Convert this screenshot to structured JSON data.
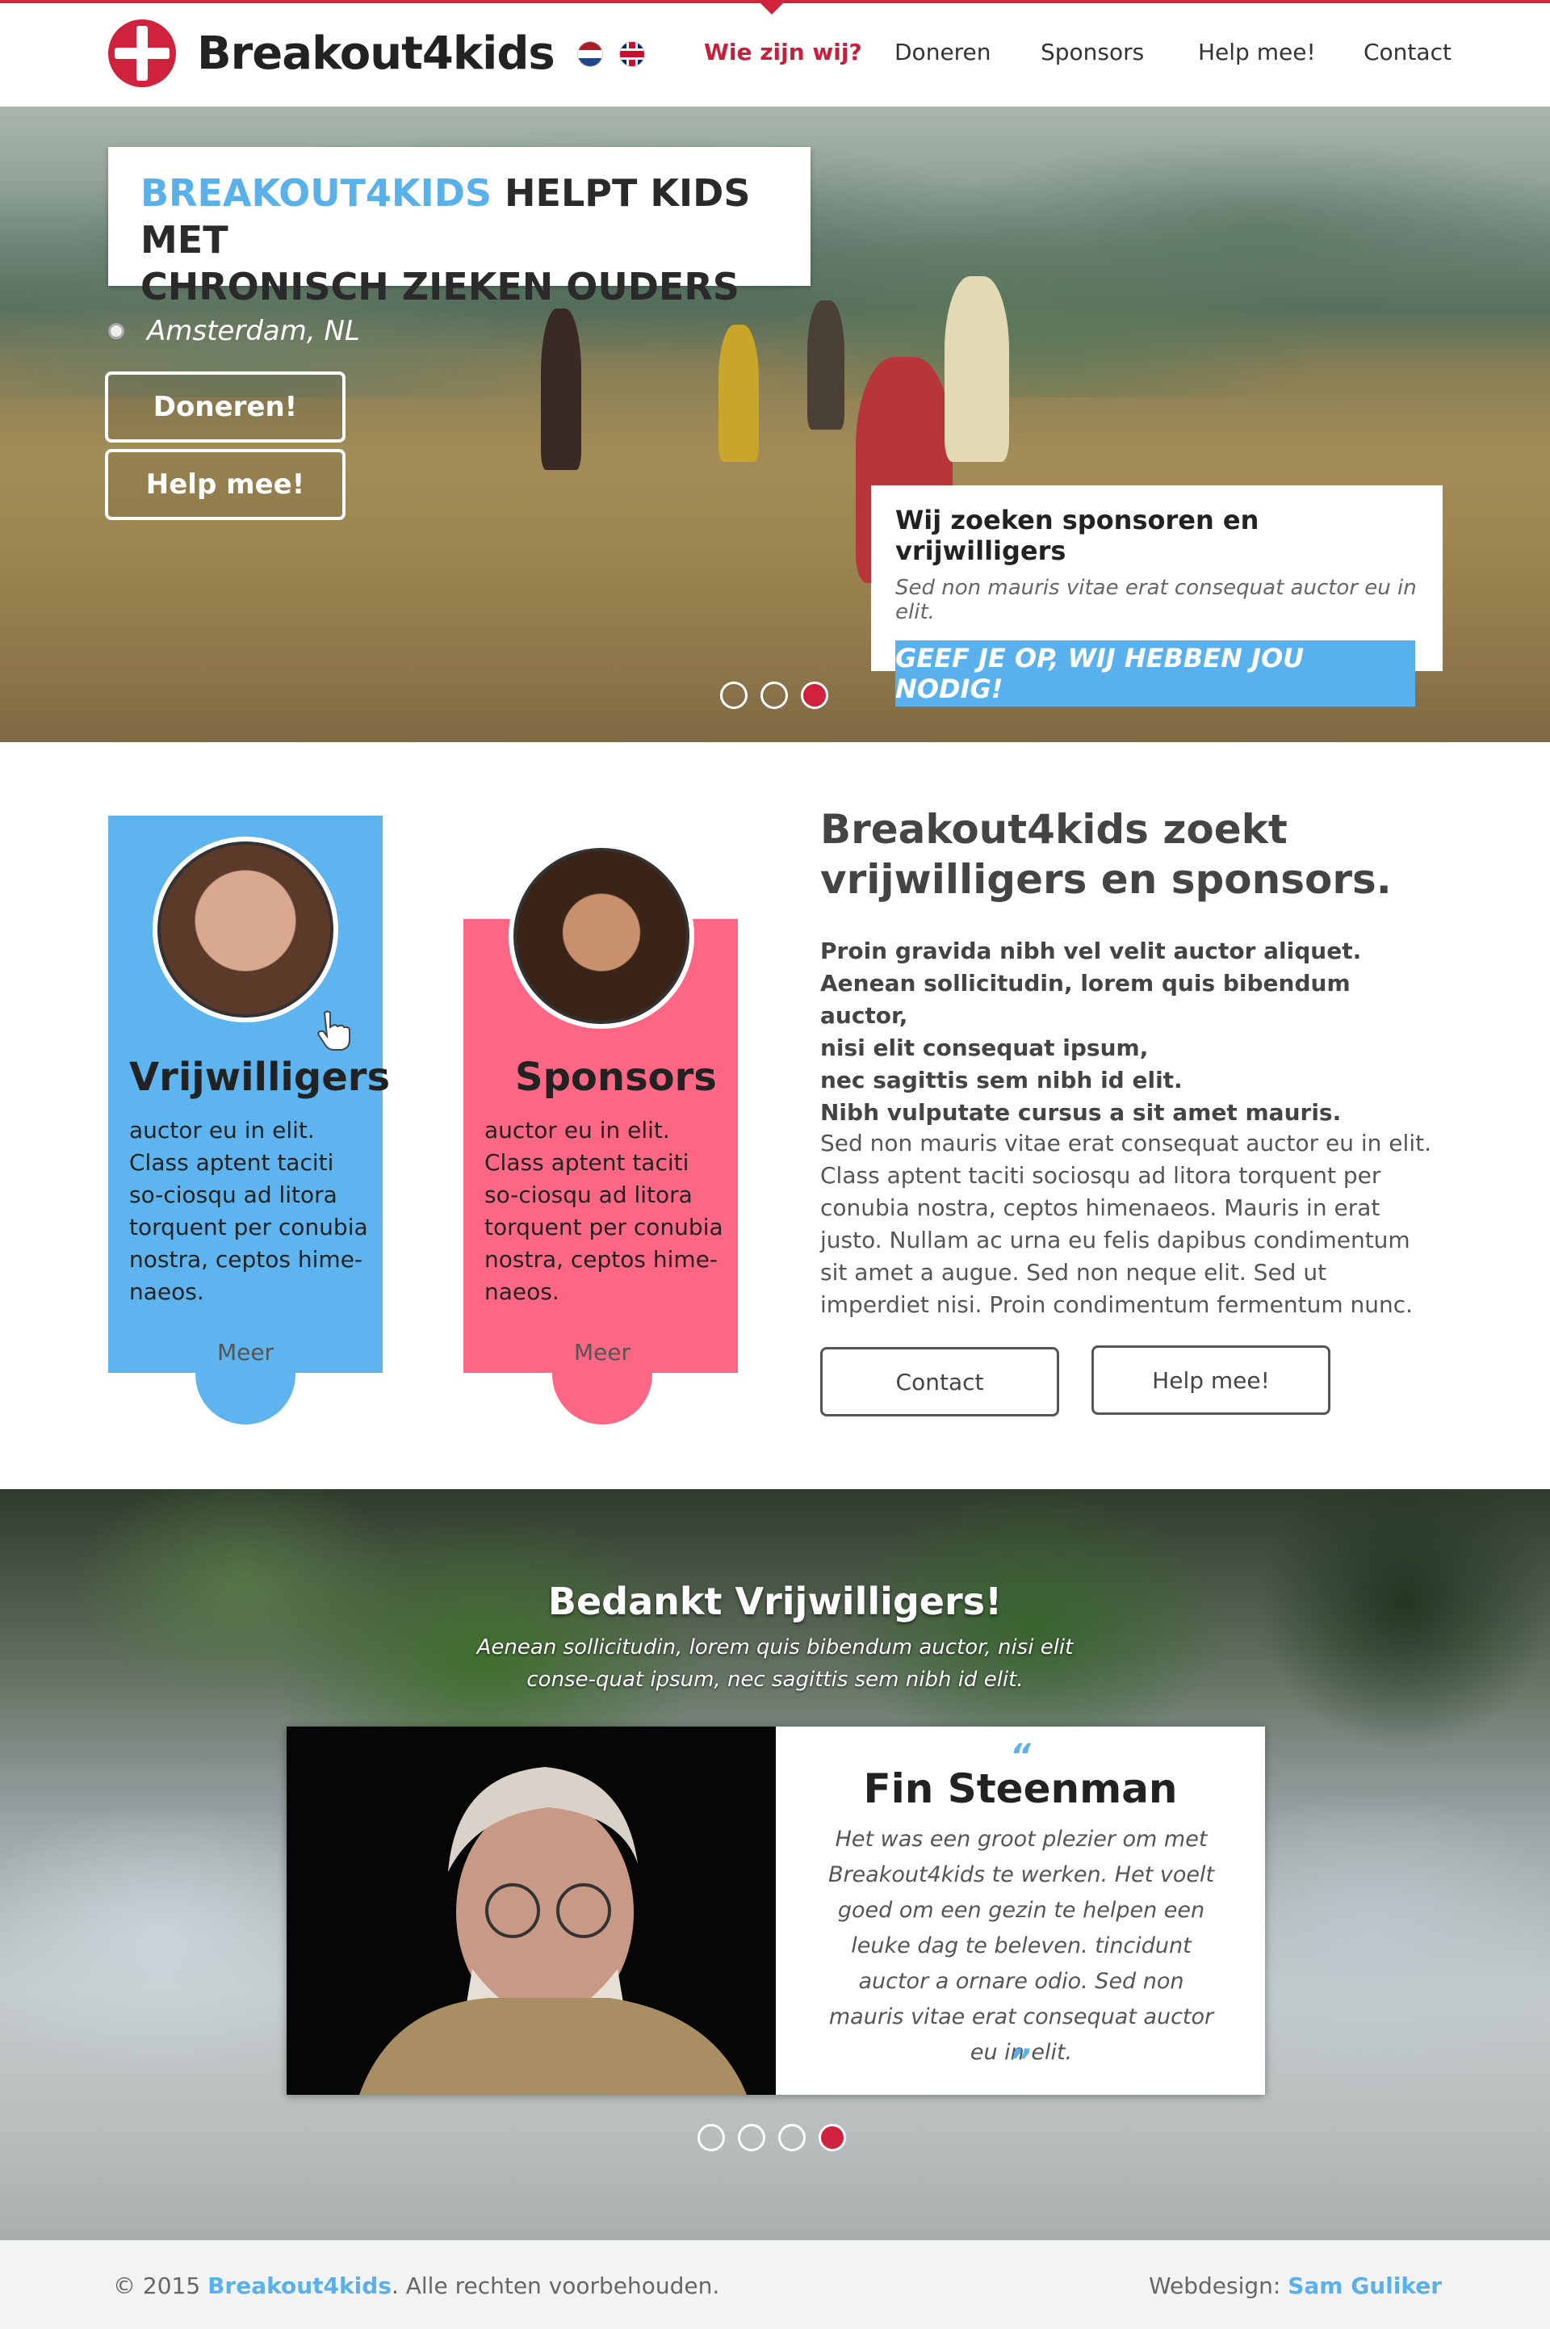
{
  "header": {
    "logo_text": "Breakout4kids",
    "nav": [
      "Wie zijn wij?",
      "Doneren",
      "Sponsors",
      "Help mee!",
      "Contact"
    ],
    "active_nav": "Wie zijn wij?",
    "flags": [
      "nl-flag-icon",
      "uk-flag-icon"
    ]
  },
  "hero": {
    "title_highlight": "BREAKOUT4KIDS",
    "title_rest_1": "HELPT KIDS MET",
    "title_rest_2": "CHRONISCH ZIEKEN OUDERS",
    "location": "Amsterdam, NL",
    "btn_donate": "Doneren!",
    "btn_help": "Help mee!",
    "sponsor_heading": "Wij zoeken sponsoren en vrijwilligers",
    "sponsor_sub": "Sed non  mauris vitae erat consequat auctor eu in elit.",
    "cta": "GEEF JE OP, WIJ HEBBEN JOU NODIG!",
    "slide_count": 3,
    "active_slide": 3
  },
  "cards": {
    "volunteers": {
      "title": "Vrijwilligers",
      "text": "auctor eu in elit. Class aptent taciti so-ciosqu ad litora torquent per conubia nostra, ceptos hime-naeos.",
      "more": "Meer"
    },
    "sponsors": {
      "title": "Sponsors",
      "text": "auctor eu in elit. Class aptent taciti so-ciosqu ad litora torquent per conubia nostra, ceptos hime-naeos.",
      "more": "Meer"
    }
  },
  "intro": {
    "heading": "Breakout4kids zoekt vrijwilligers en sponsors.",
    "bold_lines": [
      "Proin gravida nibh vel velit auctor aliquet.",
      "Aenean sollicitudin, lorem quis bibendum auctor,",
      "nisi elit consequat ipsum,",
      "nec sagittis sem nibh id elit.",
      "Nibh vulputate cursus a sit amet mauris."
    ],
    "paragraph": "Sed non  mauris vitae erat consequat auctor eu in elit. Class aptent taciti sociosqu ad litora torquent per conubia nostra, ceptos himenaeos. Mauris in erat justo. Nullam ac urna eu felis dapibus condimentum sit amet a augue. Sed non neque elit. Sed ut imperdiet nisi. Proin condimentum fermentum nunc.",
    "btn_contact": "Contact",
    "btn_help": "Help mee!"
  },
  "testimonials": {
    "heading": "Bedankt Vrijwilligers!",
    "subheading": "Aenean sollicitudin, lorem quis bibendum auctor, nisi elit conse-quat ipsum, nec sagittis sem nibh id elit.",
    "name": "Fin Steenman",
    "quote_open": "“",
    "quote_close": "”",
    "quote": "Het was een groot plezier om met Breakout4kids te werken. Het voelt goed om een gezin te helpen een leuke dag te beleven. tincidunt auctor a ornare odio. Sed non mauris vitae erat consequat auctor eu in elit.",
    "slide_count": 4,
    "active_slide": 4
  },
  "footer": {
    "copyright_prefix": "© 2015 ",
    "brand": "Breakout4kids",
    "copyright_suffix": ". Alle rechten voorbehouden.",
    "design_prefix": "Webdesign: ",
    "designer": "Sam Guliker"
  },
  "colors": {
    "brand_red": "#d0213d",
    "brand_blue": "#58b1ec",
    "volunteer_card": "#5db4ee",
    "sponsor_card": "#fe6784"
  }
}
